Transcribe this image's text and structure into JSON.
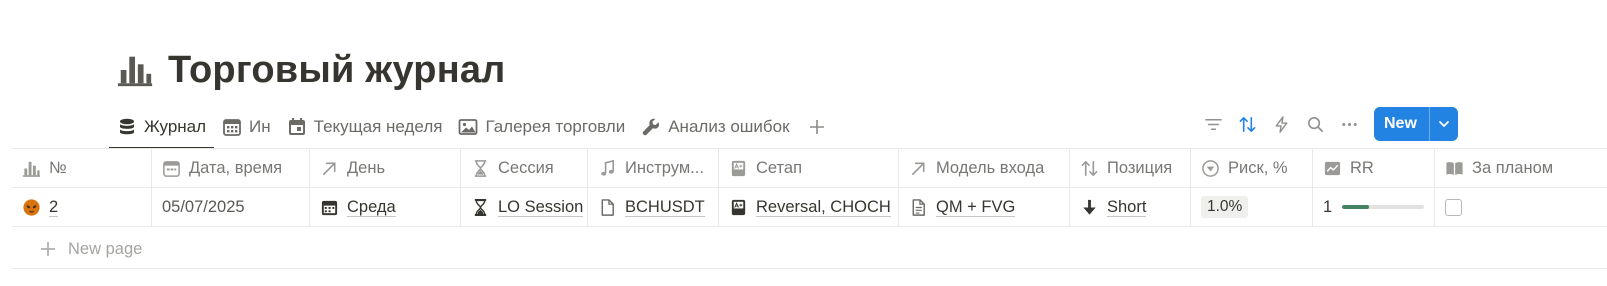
{
  "page": {
    "title": "Торговый журнал",
    "title_icon": "bar-chart-icon"
  },
  "views": [
    {
      "label": "Журнал",
      "icon": "database-icon",
      "active": true
    },
    {
      "label": "Ин",
      "icon": "calendar-icon"
    },
    {
      "label": "Текущая неделя",
      "icon": "calendar-day-icon"
    },
    {
      "label": "Галерея торговли",
      "icon": "gallery-icon"
    },
    {
      "label": "Анализ ошибок",
      "icon": "wrench-icon"
    }
  ],
  "toolbar": {
    "new_label": "New",
    "icons": [
      "filter-icon",
      "sort-icon",
      "lightning-icon",
      "search-icon",
      "more-icon"
    ],
    "accent": "#2383e2"
  },
  "columns": [
    {
      "label": "№",
      "icon": "bar-chart-icon"
    },
    {
      "label": "Дата, время",
      "icon": "calendar-icon"
    },
    {
      "label": "День",
      "icon": "arrow-up-right-icon"
    },
    {
      "label": "Сессия",
      "icon": "hourglass-icon"
    },
    {
      "label": "Инструм...",
      "icon": "music-note-icon"
    },
    {
      "label": "Сетап",
      "icon": "setup-icon"
    },
    {
      "label": "Модель входа",
      "icon": "arrow-up-right-icon"
    },
    {
      "label": "Позиция",
      "icon": "sort-arrows-icon"
    },
    {
      "label": "Риск, %",
      "icon": "circle-down-icon"
    },
    {
      "label": "RR",
      "icon": "chart-line-icon"
    },
    {
      "label": "За планом",
      "icon": "book-icon"
    }
  ],
  "rows": [
    {
      "number": "2",
      "row_icon": "alien-face-icon",
      "datetime": "05/07/2025",
      "day": "Среда",
      "session": "LO Session",
      "instrument": "BCHUSDT",
      "setup": "Reversal, CHOCH",
      "entry_model": "QM + FVG",
      "position": "Short",
      "risk": "1.0%",
      "rr": "1",
      "rr_progress": 0.33,
      "according_to_plan": false
    }
  ],
  "new_page_label": "New page"
}
